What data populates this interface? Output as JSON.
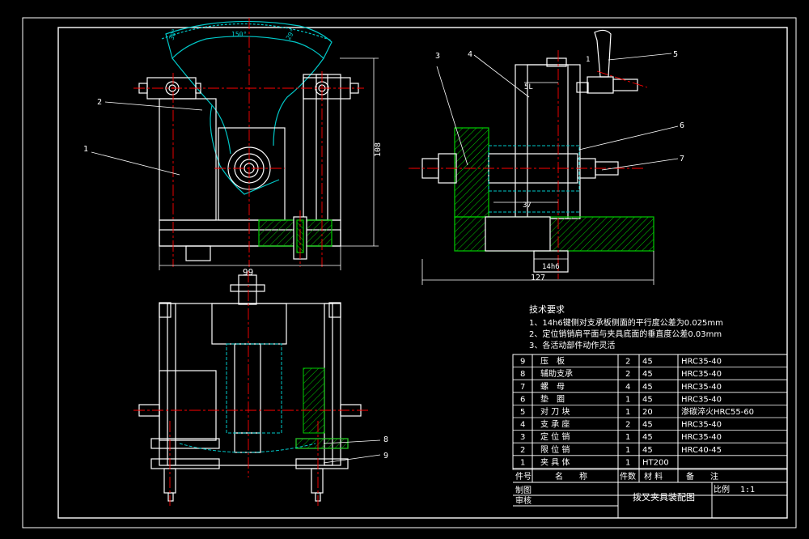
{
  "tech_requirements": {
    "title": "技术要求",
    "items": [
      "1、14h6键侧对支承板侧面的平行度公差为0.025mm",
      "2、定位销销肩平面与夹具底面的垂直度公差0.03mm",
      "3、各活动部件动作灵活"
    ]
  },
  "dimensions": {
    "width_99": "99",
    "height_108": "108",
    "width_127": "127",
    "key_14h6": "14h6",
    "dim_37": "37",
    "angle_150": "150°",
    "angle_29": "29°",
    "angle_30": "30°",
    "dim_5l": "5L",
    "dim_1": "1"
  },
  "leaders": {
    "n1": "1",
    "n2": "2",
    "n3": "3",
    "n4": "4",
    "n5": "5",
    "n6": "6",
    "n7": "7",
    "n8": "8",
    "n9": "9"
  },
  "parts_table": {
    "rows": [
      {
        "no": "9",
        "name": "压　板",
        "qty": "2",
        "material": "45",
        "note": "HRC35-40"
      },
      {
        "no": "8",
        "name": "辅助支承",
        "qty": "2",
        "material": "45",
        "note": "HRC35-40"
      },
      {
        "no": "7",
        "name": "螺　母",
        "qty": "4",
        "material": "45",
        "note": "HRC35-40"
      },
      {
        "no": "6",
        "name": "垫　圈",
        "qty": "1",
        "material": "45",
        "note": "HRC35-40"
      },
      {
        "no": "5",
        "name": "对 刀 块",
        "qty": "1",
        "material": "20",
        "note": "渗碳淬火HRC55-60"
      },
      {
        "no": "4",
        "name": "支 承 座",
        "qty": "2",
        "material": "45",
        "note": "HRC35-40"
      },
      {
        "no": "3",
        "name": "定 位 销",
        "qty": "1",
        "material": "45",
        "note": "HRC35-40"
      },
      {
        "no": "2",
        "name": "限 位 销",
        "qty": "1",
        "material": "45",
        "note": "HRC40-45"
      },
      {
        "no": "1",
        "name": "夹 具 体",
        "qty": "1",
        "material": "HT200",
        "note": ""
      }
    ],
    "header": {
      "no": "件号",
      "name": "名　　称",
      "qty": "件数",
      "material": "材 料",
      "note": "备　　注"
    }
  },
  "title_block": {
    "drawn": "制图",
    "checked": "审核",
    "title": "拨叉夹具装配图",
    "scale_label": "比例",
    "scale_value": "1:1"
  },
  "colors": {
    "background": "#000000",
    "outline": "#ffffff",
    "center_line": "#ff0000",
    "hatch": "#00cc00",
    "cyan": "#00c8c8",
    "frame": "#ffffff",
    "magenta": "#e000e0",
    "yellow": "#e0e000"
  }
}
